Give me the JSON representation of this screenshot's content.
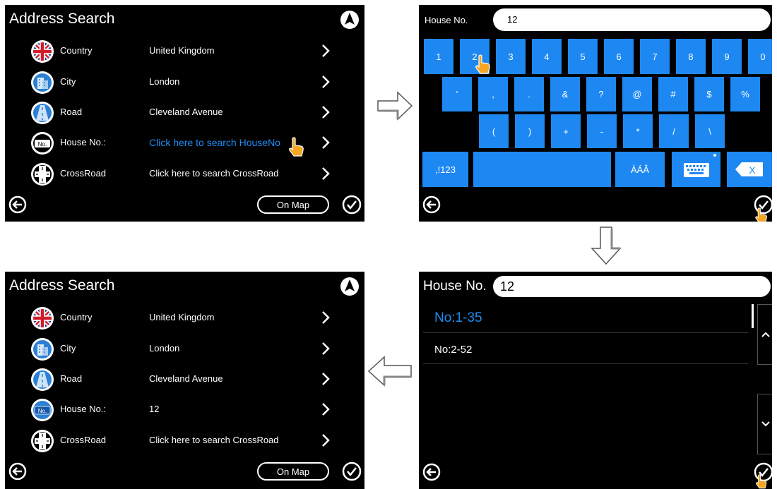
{
  "address_search": {
    "title": "Address Search",
    "on_map_label": "On Map",
    "before": [
      {
        "icon": "uk-flag-icon",
        "label": "Country",
        "value": "United Kingdom"
      },
      {
        "icon": "city-icon",
        "label": "City",
        "value": "London"
      },
      {
        "icon": "road-icon",
        "label": "Road",
        "value": "Cleveland Avenue"
      },
      {
        "icon": "house-number-icon",
        "label": "House No.:",
        "value": "Click here to search HouseNo"
      },
      {
        "icon": "crossroad-icon",
        "label": "CrossRoad",
        "value": "Click here to search CrossRoad"
      }
    ],
    "after": [
      {
        "icon": "uk-flag-icon",
        "label": "Country",
        "value": "United Kingdom"
      },
      {
        "icon": "city-icon",
        "label": "City",
        "value": "London"
      },
      {
        "icon": "road-icon",
        "label": "Road",
        "value": "Cleveland Avenue"
      },
      {
        "icon": "house-number-icon",
        "label": "House No.:",
        "value": "12"
      },
      {
        "icon": "crossroad-icon",
        "label": "CrossRoad",
        "value": "Click here to search CrossRoad"
      }
    ]
  },
  "keyboard": {
    "label": "House No.",
    "value": "12",
    "row1": [
      "1",
      "2",
      "3",
      "4",
      "5",
      "6",
      "7",
      "8",
      "9",
      "0"
    ],
    "row2": [
      "'",
      ",",
      ".",
      "&",
      "?",
      "@",
      "#",
      "$",
      "%"
    ],
    "row3": [
      "(",
      ")",
      "+",
      "-",
      "*",
      "/",
      "\\"
    ],
    "mode_key": ",!123",
    "accent_key": "ÀÁÂ",
    "backspace_label": "X"
  },
  "results": {
    "label": "House No.",
    "value": "12",
    "items": [
      "No:1-35",
      "No:2-52"
    ],
    "selected_color": "#1f8cf0"
  },
  "colors": {
    "accent": "#1e88f2",
    "background": "#000000"
  }
}
